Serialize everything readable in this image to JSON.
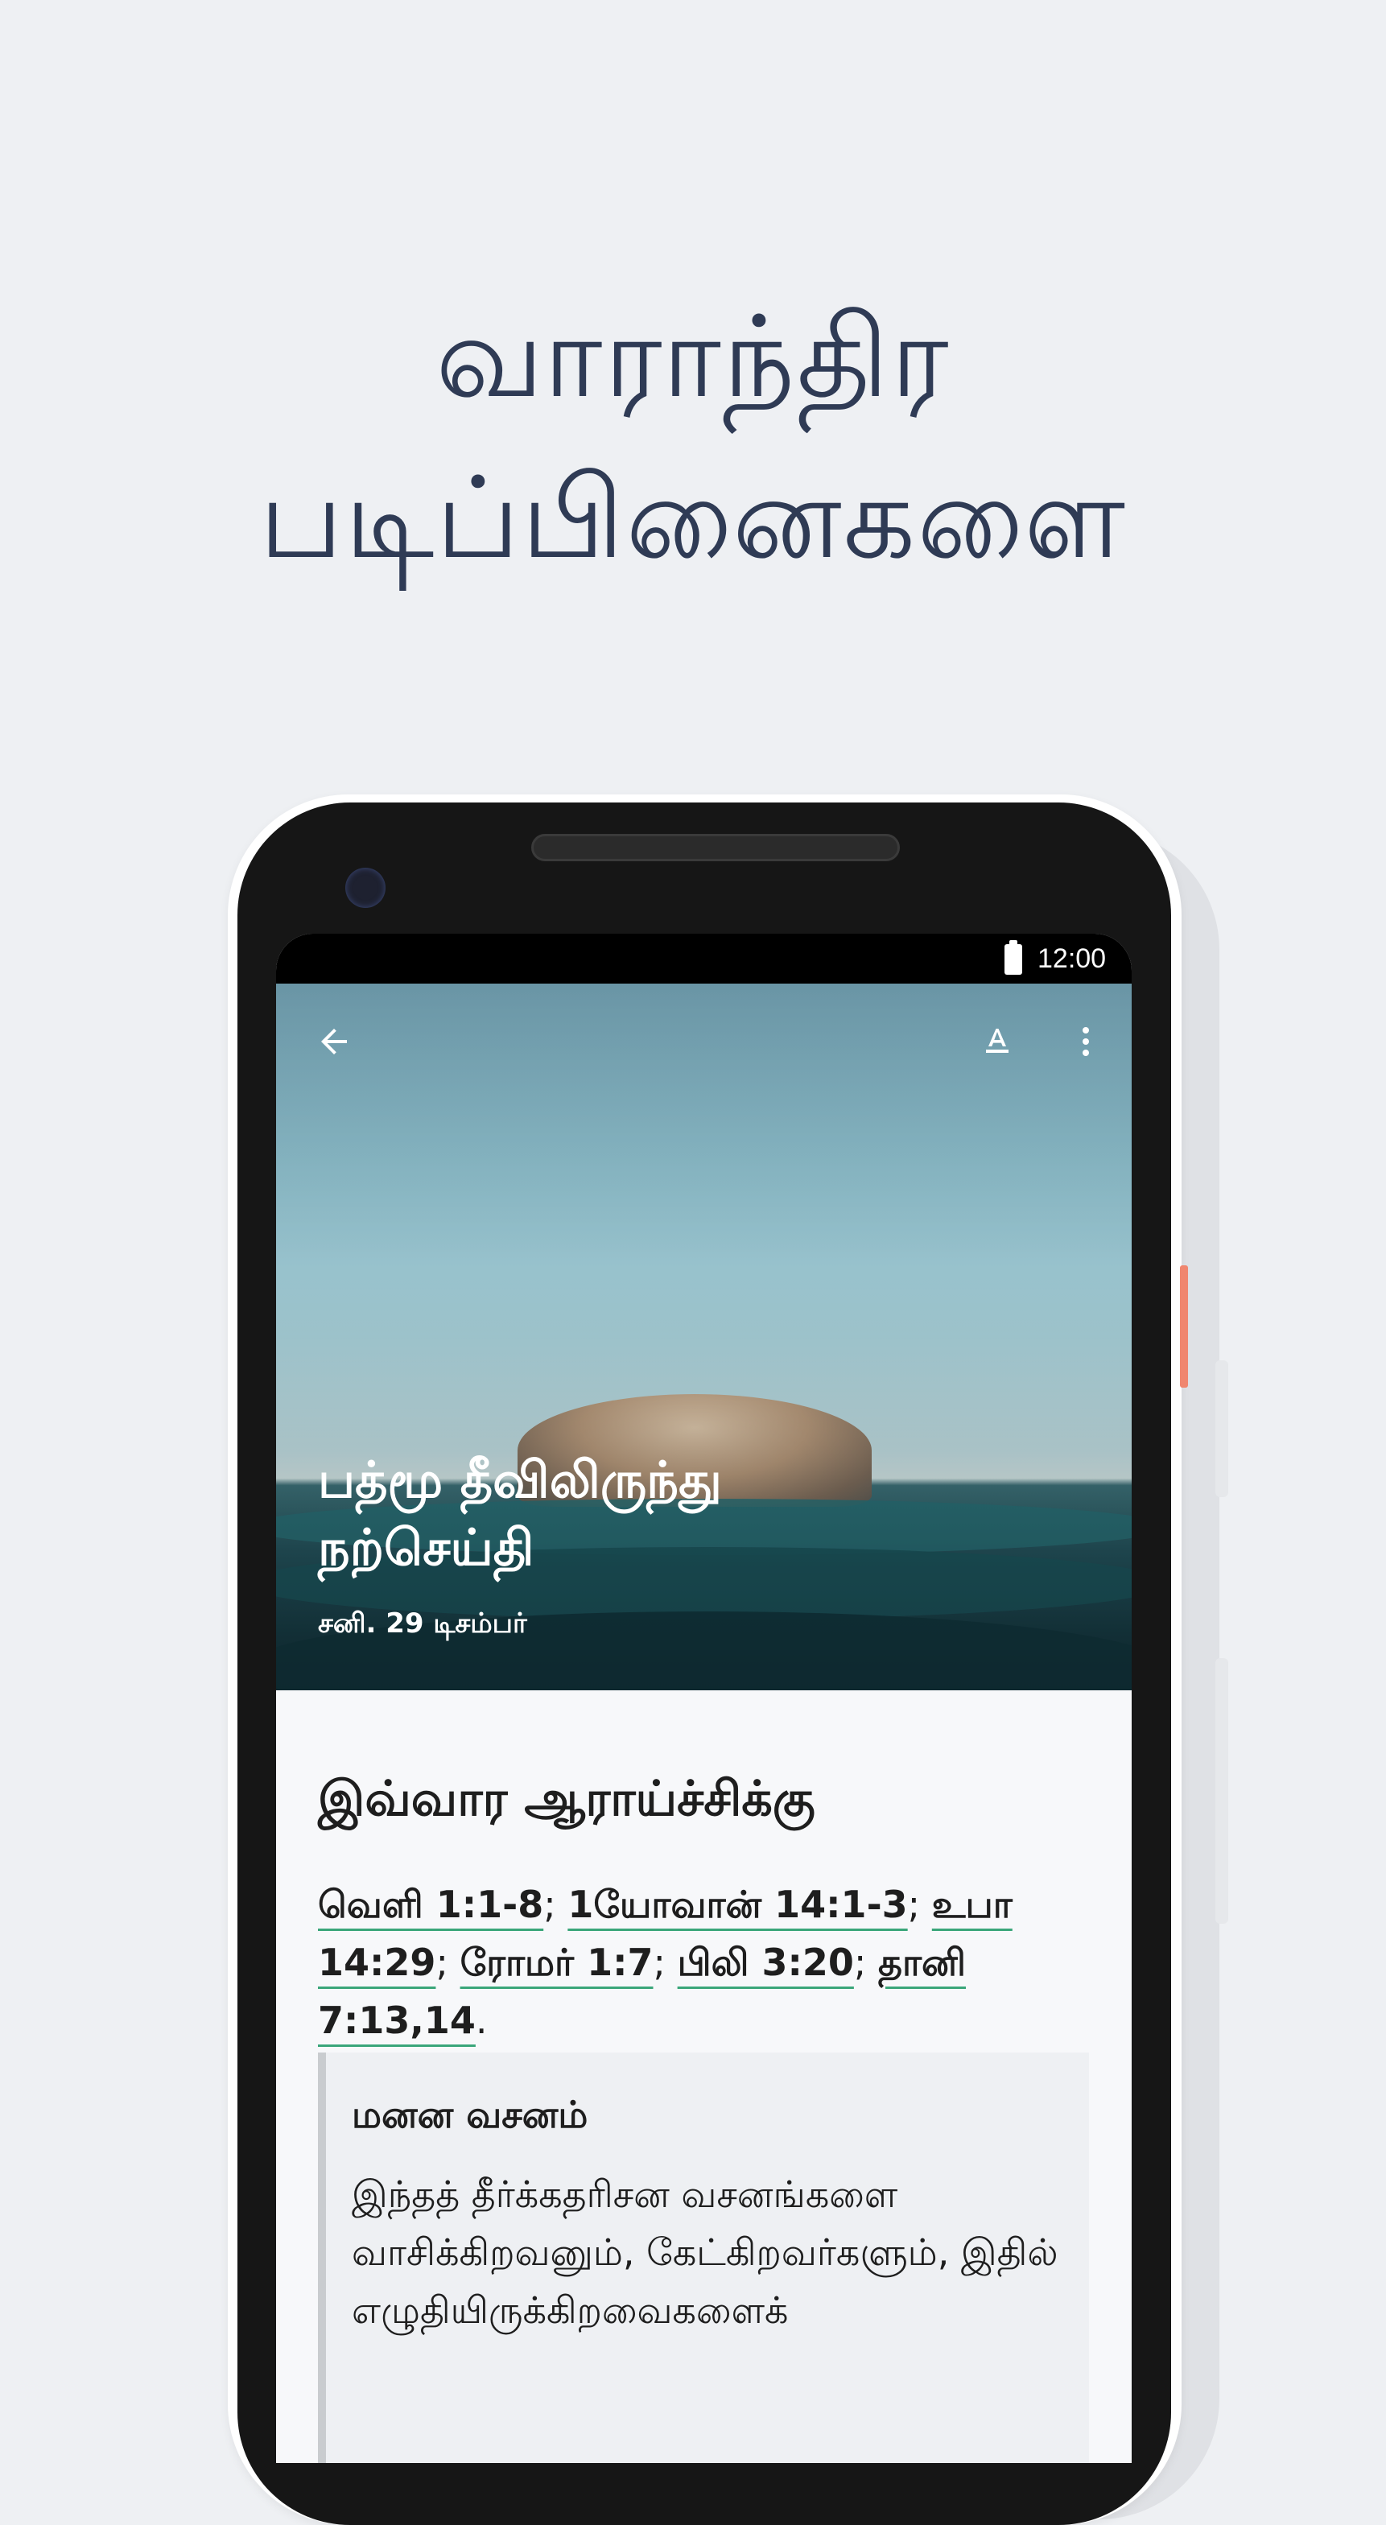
{
  "headline": {
    "line1": "வாராந்திர",
    "line2": "படிப்பினைகளை"
  },
  "status_bar": {
    "time": "12:00"
  },
  "toolbar": {
    "back_icon": "arrow-left-icon",
    "text_size_icon": "text-format-icon",
    "more_icon": "more-vert-icon"
  },
  "lesson": {
    "title_line1": "பத்மூ தீவிலிருந்து",
    "title_line2": "நற்செய்தி",
    "date": "சனி. 29 டிசம்பர்"
  },
  "study": {
    "heading": "இவ்வார ஆராய்ச்சிக்கு",
    "references": [
      "வெளி 1:1-8",
      "1யோவான் 14:1-3",
      "உபா 14:29",
      "ரோமர் 1:7",
      "பிலி 3:20",
      "தானி 7:13,14"
    ],
    "separator": "; ",
    "end": "."
  },
  "memory": {
    "title": "மனன வசனம்",
    "text": "இந்தத் தீர்க்கதரிசன வசனங்களை வாசிக்கிறவனும், கேட்கிறவர்களும், இதில் எழுதியிருக்கிறவைகளைக்"
  },
  "colors": {
    "background": "#eef0f3",
    "headline": "#2f3b55",
    "link_underline": "#3aa67a",
    "accent_button": "#f0866f"
  }
}
